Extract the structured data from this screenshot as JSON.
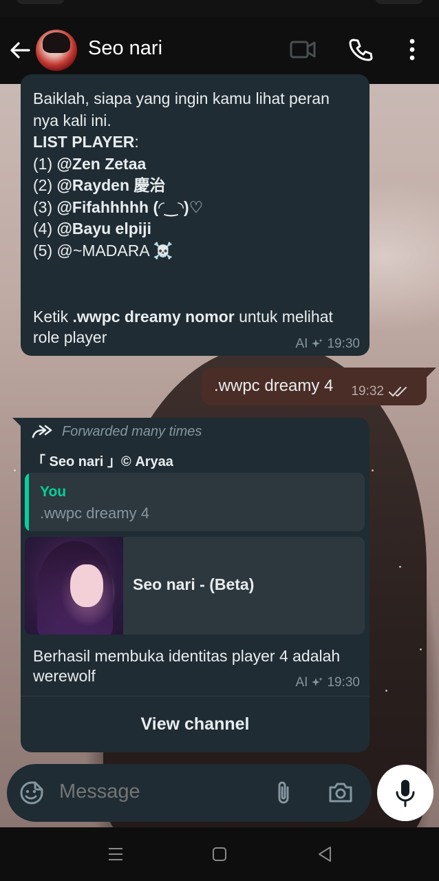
{
  "header": {
    "contact_name": "Seo nari"
  },
  "messages": {
    "msg1": {
      "intro": "Baiklah, siapa yang ingin kamu lihat peran nya kali ini.",
      "list_heading": "LIST PLAYER",
      "list_heading_suffix": ":",
      "players": [
        {
          "num": "(1) ",
          "name": "@Zen Zetaa"
        },
        {
          "num": "(2) ",
          "name": "@Rayden 慶治"
        },
        {
          "num": "(3) ",
          "name": "@Fifahhhhh (◜‿◝)♡"
        },
        {
          "num": "(4) ",
          "name": "@Bayu elpiji"
        },
        {
          "num": "(5) ",
          "name": "@~MADARA ☠️"
        }
      ],
      "footer_prefix": "Ketik ",
      "footer_command": ".wwpc dreamy nomor",
      "footer_suffix": " untuk melihat role player",
      "ai_label": "AI",
      "time": "19:30"
    },
    "outgoing": {
      "text": ".wwpc dreamy 4",
      "time": "19:32"
    },
    "msg2": {
      "forwarded_label": "Forwarded many times",
      "sender": "「 Seo nari 」© Aryaa",
      "quote_author": "You",
      "quote_text": ".wwpc dreamy 4",
      "link_title": "Seo nari - (Beta)",
      "body": "Berhasil membuka identitas player 4 adalah werewolf",
      "ai_label": "AI",
      "time": "19:30",
      "view_channel": "View channel"
    }
  },
  "input": {
    "placeholder": "Message"
  },
  "colors": {
    "incoming_bubble": "#1f2c33",
    "outgoing_bubble": "#4a2d26",
    "accent_green": "#06cf9c",
    "meta_text": "#8696a0"
  }
}
